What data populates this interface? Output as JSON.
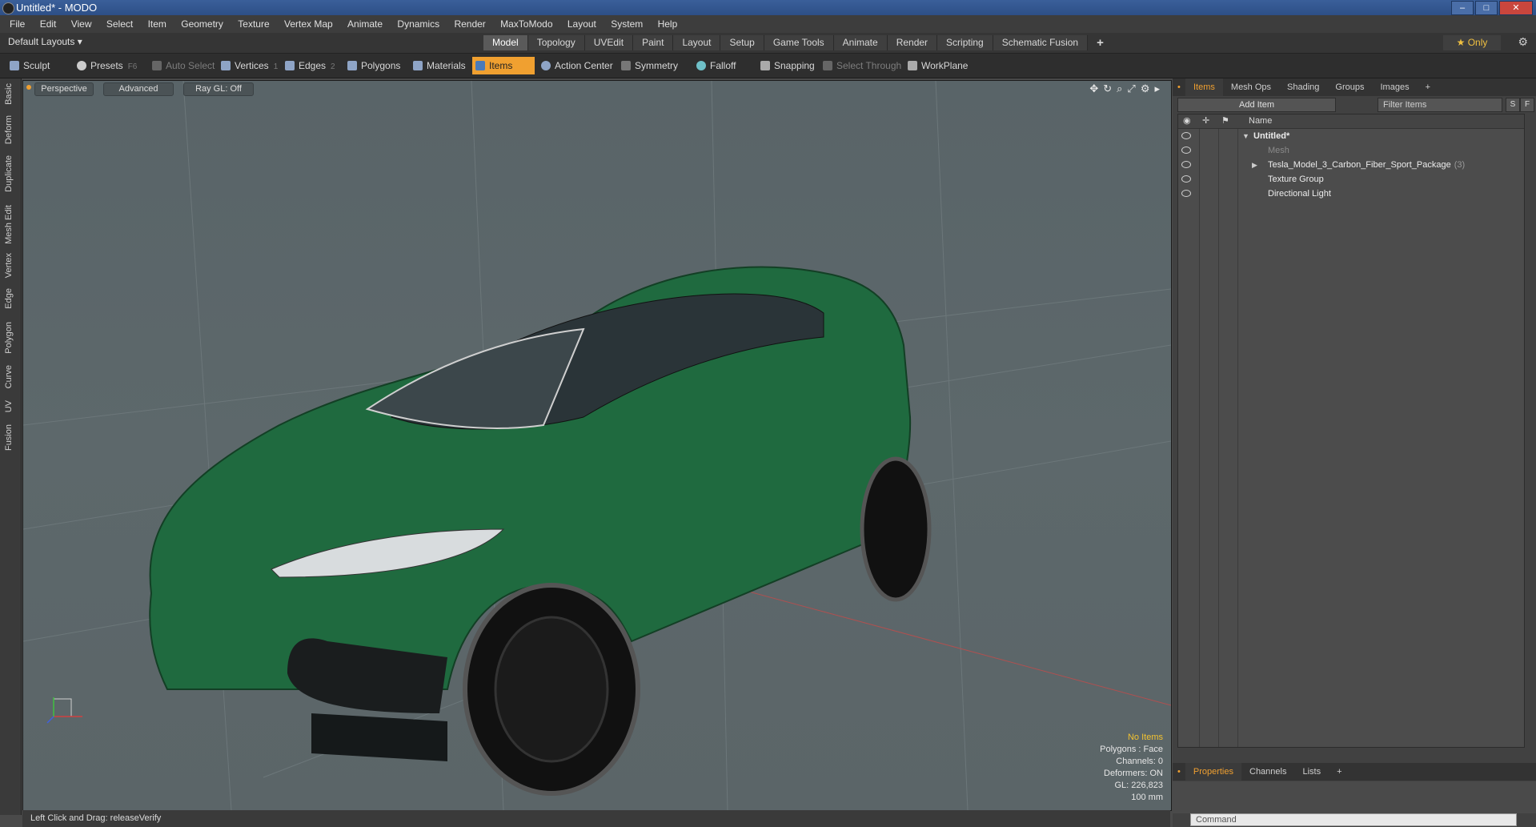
{
  "window": {
    "title": "Untitled* - MODO"
  },
  "menu": [
    "File",
    "Edit",
    "View",
    "Select",
    "Item",
    "Geometry",
    "Texture",
    "Vertex Map",
    "Animate",
    "Dynamics",
    "Render",
    "MaxToModo",
    "Layout",
    "System",
    "Help"
  ],
  "layouts": {
    "default_label": "Default Layouts ▾",
    "tabs": [
      "Model",
      "Topology",
      "UVEdit",
      "Paint",
      "Layout",
      "Setup",
      "Game Tools",
      "Animate",
      "Render",
      "Scripting",
      "Schematic Fusion"
    ],
    "active_tab": "Model",
    "add_label": "+",
    "only_label": "★  Only"
  },
  "toolbar": {
    "sculpt": "Sculpt",
    "presets": "Presets",
    "presets_key": "F6",
    "auto_select": "Auto Select",
    "vertices": "Vertices",
    "vertices_key": "1",
    "edges": "Edges",
    "edges_key": "2",
    "polygons": "Polygons",
    "materials": "Materials",
    "items": "Items",
    "action_center": "Action Center",
    "symmetry": "Symmetry",
    "falloff": "Falloff",
    "snapping": "Snapping",
    "select_through": "Select Through",
    "workplane": "WorkPlane"
  },
  "left_tabs": [
    "Basic",
    "Deform",
    "Duplicate",
    "Mesh Edit",
    "Vertex",
    "Edge",
    "Polygon",
    "Curve",
    "UV",
    "Fusion"
  ],
  "viewport": {
    "perspective": "Perspective",
    "advanced": "Advanced",
    "raygl": "Ray GL: Off",
    "info": {
      "no_items": "No Items",
      "polygons": "Polygons : Face",
      "channels": "Channels: 0",
      "deformers": "Deformers: ON",
      "gl": "GL: 226,823",
      "scale": "100 mm"
    }
  },
  "status": {
    "hint": "Left Click and Drag:  releaseVerify"
  },
  "items_panel": {
    "tabs": [
      "Items",
      "Mesh Ops",
      "Shading",
      "Groups",
      "Images",
      "+"
    ],
    "add_item": "Add Item",
    "filter": "Filter Items",
    "s_btn": "S",
    "f_btn": "F",
    "col_name": "Name",
    "rows": [
      {
        "label": "Untitled*",
        "count": ""
      },
      {
        "label": "Mesh",
        "count": ""
      },
      {
        "label": "Tesla_Model_3_Carbon_Fiber_Sport_Package",
        "count": "(3)"
      },
      {
        "label": "Texture Group",
        "count": ""
      },
      {
        "label": "Directional Light",
        "count": ""
      }
    ]
  },
  "properties_panel": {
    "tabs": [
      "Properties",
      "Channels",
      "Lists",
      "+"
    ],
    "command_placeholder": "Command"
  },
  "colors": {
    "accent": "#f0a030",
    "car_body": "#1f6a3f",
    "viewport_bg": "#5b6568"
  }
}
